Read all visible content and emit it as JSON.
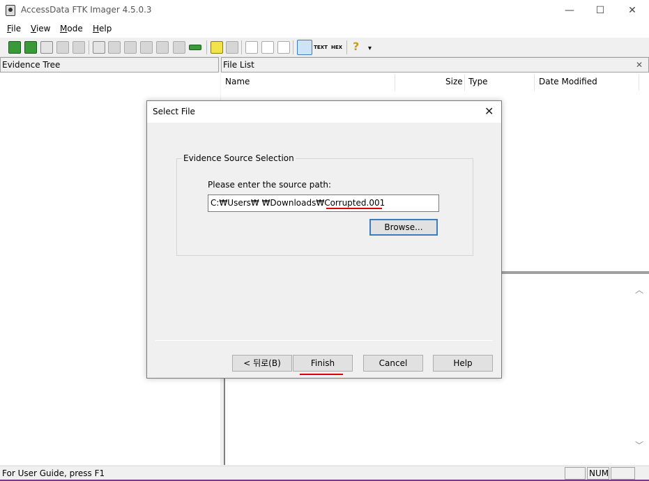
{
  "window": {
    "title": "AccessData FTK Imager 4.5.0.3",
    "minimize": "—",
    "maximize": "☐",
    "close": "✕"
  },
  "menu": [
    {
      "key": "F",
      "rest": "ile"
    },
    {
      "key": "V",
      "rest": "iew"
    },
    {
      "key": "M",
      "rest": "ode"
    },
    {
      "key": "H",
      "rest": "elp"
    }
  ],
  "toolbar": {
    "text_view": "TEXT",
    "hex_view": "HEX",
    "help_icon": "?",
    "dropdown": "▾"
  },
  "evidence_tree": {
    "header": "Evidence Tree"
  },
  "file_list": {
    "header": "File List",
    "close": "✕",
    "columns": [
      "Name",
      "Size",
      "Type",
      "Date Modified"
    ]
  },
  "viewer": {
    "scroll_up": "︿",
    "scroll_down": "﹀"
  },
  "status": {
    "text": "For User Guide, press F1",
    "num": "NUM"
  },
  "dialog": {
    "title": "Select File",
    "close": "✕",
    "group_label": "Evidence Source Selection",
    "prompt": "Please enter the source path:",
    "path_value": "C:₩Users₩      ₩Downloads₩Corrupted.001",
    "browse_label": "Browse...",
    "back_label": "< 뒤로(B)",
    "finish_label": "Finish",
    "cancel_label": "Cancel",
    "help_label": "Help"
  },
  "colors": {
    "accent": "#3b7bbf",
    "annotation_red": "#dd0000"
  }
}
